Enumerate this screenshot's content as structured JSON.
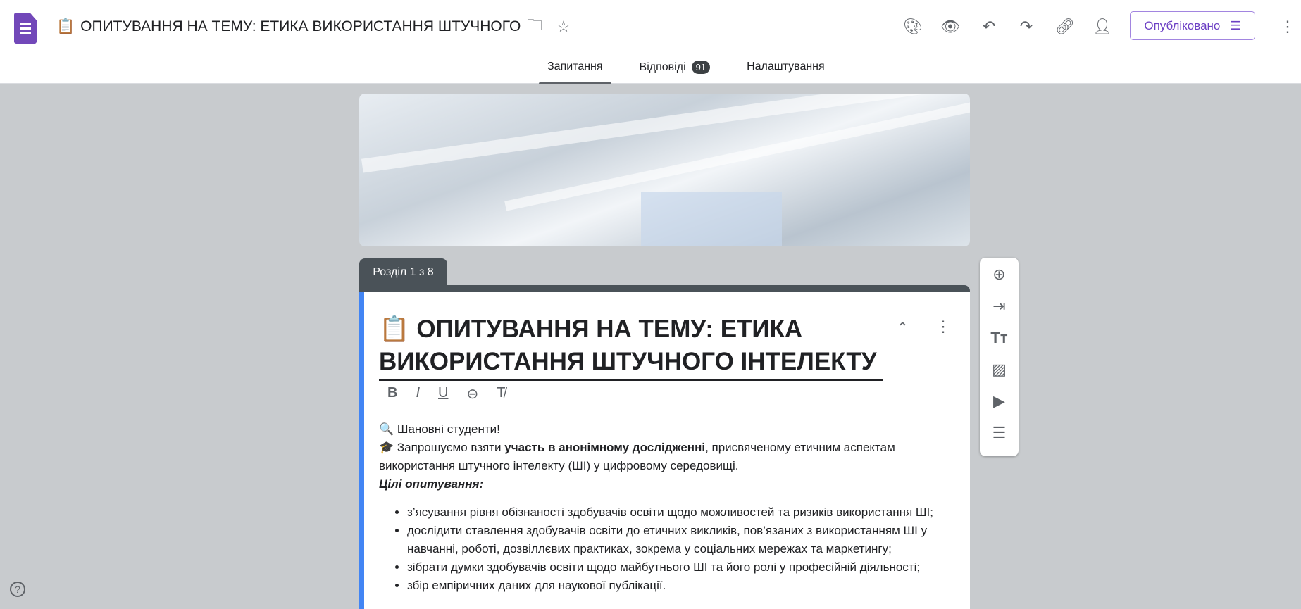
{
  "header": {
    "doc_emoji": "📋",
    "doc_title": "ОПИТУВАННЯ НА ТЕМУ: ЕТИКА ВИКОРИСТАННЯ ШТУЧНОГО ІНТЕЛЕКТУ",
    "publish_label": "Опубліковано"
  },
  "tabs": [
    {
      "label": "Запитання"
    },
    {
      "label": "Відповіді",
      "badge": "91"
    },
    {
      "label": "Налаштування"
    }
  ],
  "section": {
    "label": "Розділ 1 з 8"
  },
  "form": {
    "emoji": "📋",
    "title": "ОПИТУВАННЯ НА ТЕМУ: ЕТИКА ВИКОРИСТАННЯ ШТУЧНОГО ІНТЕЛЕКТУ",
    "greeting": "🔍 Шановні студенти!",
    "invite_pre": "🎓 Запрошуємо взяти ",
    "invite_bold": "участь в анонімному дослідженні",
    "invite_post": ", присвяченому етичним аспектам використання штучного інтелекту (ШІ) у цифровому середовищі.",
    "goals_heading": "Цілі опитування:",
    "goals": [
      "з’ясування рівня обізнаності здобувачів освіти щодо можливостей та ризиків використання ШІ;",
      "дослідити ставлення здобувачів освіти до етичних викликів, пов’язаних з використанням ШІ у навчанні, роботі, дозвіллєвих практиках, зокрема у соціальних мережах та маркетингу;",
      "зібрати думки здобувачів освіти щодо майбутнього ШІ та його ролі у професійній діяльності;",
      "збір емпіричних даних для наукової публікації."
    ]
  }
}
